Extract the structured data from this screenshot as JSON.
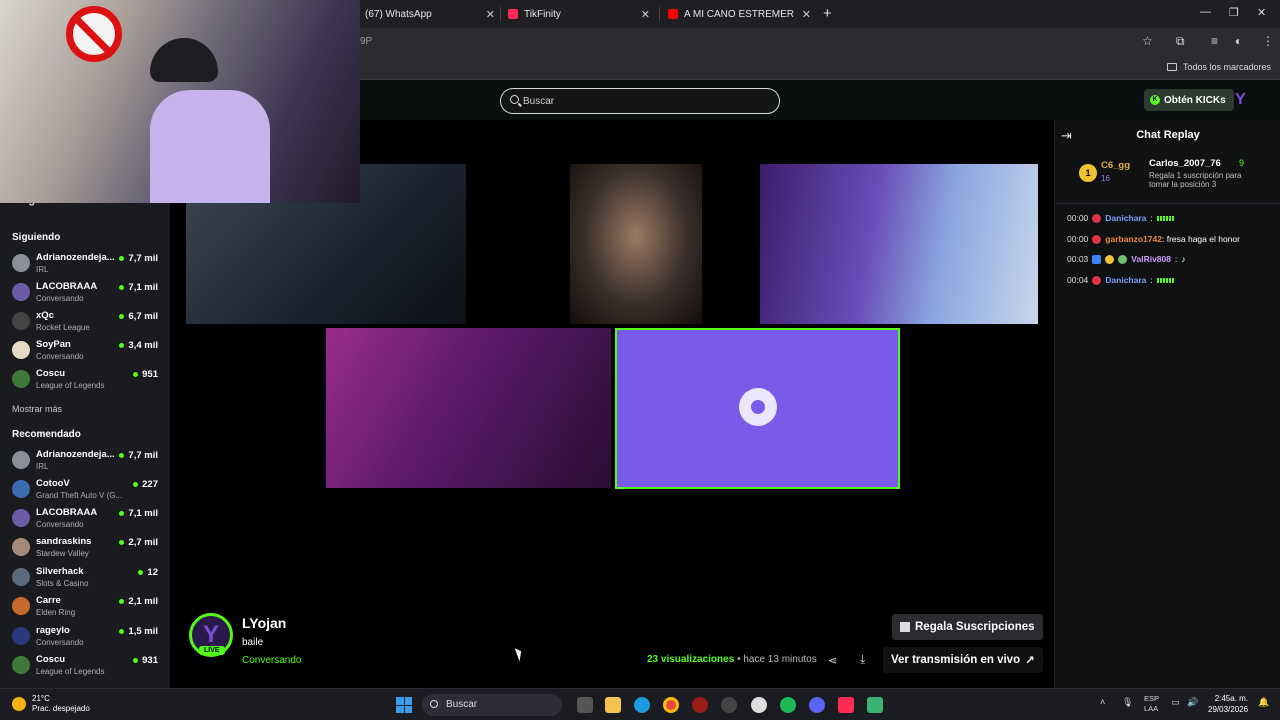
{
  "browser": {
    "tabs": [
      {
        "label": "(67) WhatsApp",
        "color": "#25d366"
      },
      {
        "label": "TikFinity",
        "color": "#ff2a55"
      },
      {
        "label": "A MI CANO ESTREMERA LETRA",
        "color": "#ff0000"
      }
    ],
    "address_fragment": "9P",
    "bookmarks_all": "Todos los marcadores"
  },
  "header": {
    "search_placeholder": "Buscar",
    "kicks_button": "Obtén KICKs",
    "brand_color": "#53fc18"
  },
  "sidebar": {
    "following_top": "Siguiendo",
    "following_header": "Siguiendo",
    "following": [
      {
        "name": "Adrianozendeja...",
        "category": "IRL",
        "viewers": "7,7 mil",
        "color": "#8a8f98"
      },
      {
        "name": "LACOBRAAA",
        "category": "Conversando",
        "viewers": "7,1 mil",
        "color": "#6b5ca5"
      },
      {
        "name": "xQc",
        "category": "Rocket League",
        "viewers": "6,7 mil",
        "color": "#444"
      },
      {
        "name": "SoyPan",
        "category": "Conversando",
        "viewers": "3,4 mil",
        "color": "#e8d9c4"
      },
      {
        "name": "Coscu",
        "category": "League of Legends",
        "viewers": "951",
        "color": "#3f7a3a"
      }
    ],
    "show_more": "Mostrar más",
    "recommended_header": "Recomendado",
    "recommended": [
      {
        "name": "Adrianozendeja...",
        "category": "IRL",
        "viewers": "7,7 mil",
        "color": "#8a8f98"
      },
      {
        "name": "CotooV",
        "category": "Grand Theft Auto V (G...",
        "viewers": "227",
        "color": "#3b6db1"
      },
      {
        "name": "LACOBRAAA",
        "category": "Conversando",
        "viewers": "7,1 mil",
        "color": "#6b5ca5"
      },
      {
        "name": "sandraskins",
        "category": "Stardew Valley",
        "viewers": "2,7 mil",
        "color": "#a68a79"
      },
      {
        "name": "Silverhack",
        "category": "Slots & Casino",
        "viewers": "12",
        "color": "#5b6a7c"
      },
      {
        "name": "Carre",
        "category": "Elden Ring",
        "viewers": "2,1 mil",
        "color": "#c46a2a"
      },
      {
        "name": "rageylo",
        "category": "Conversando",
        "viewers": "1,5 mil",
        "color": "#2b3a80"
      },
      {
        "name": "Coscu",
        "category": "League of Legends",
        "viewers": "931",
        "color": "#3f7a3a"
      }
    ]
  },
  "stream": {
    "channel": "LYojan",
    "title": "baile",
    "category": "Conversando",
    "live_badge": "LIVE",
    "avatar_letter": "Y",
    "views_count": "23",
    "views_label": "visualizaciones",
    "time_ago": "• hace 13 minutos",
    "gift_button": "Regala Suscripciones",
    "watch_live_button": "Ver transmisión en vivo"
  },
  "chat": {
    "title": "Chat Replay",
    "pinned": {
      "rank": "1",
      "user1": "C6_gg",
      "user1_count": "16",
      "user2": "Carlos_2007_76",
      "user2_count": "9",
      "message": "Regala 1 suscripción para tomar la posición 3"
    },
    "messages": [
      {
        "time": "00:00",
        "user": "Danichara",
        "user_color": "#7aa2ff",
        "text": ""
      },
      {
        "time": "00:00",
        "user": "garbanzo1742",
        "user_color": "#f08b3a",
        "text": ": fresa haga el honor"
      },
      {
        "time": "00:03",
        "user": "ValRiv808",
        "user_color": "#c9a0ff",
        "text": ""
      },
      {
        "time": "00:04",
        "user": "Danichara",
        "user_color": "#7aa2ff",
        "text": ""
      }
    ]
  },
  "taskbar": {
    "temp": "21°C",
    "weather": "Prac. despejado",
    "search": "Buscar",
    "lang1": "ESP",
    "lang2": "LAA",
    "time": "2:45a. m.",
    "date": "29/03/2026"
  }
}
